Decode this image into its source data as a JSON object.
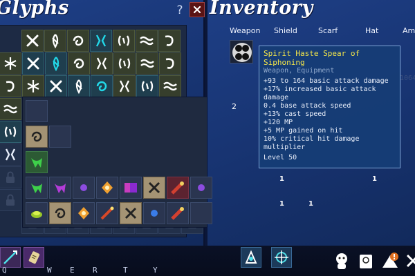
{
  "glyph_panel": {
    "title": "Glyphs",
    "help_label": "?",
    "close_icon": "close-icon"
  },
  "inventory_panel": {
    "title": "Inventory",
    "equipment_tabs": [
      "Weapon",
      "Shield",
      "Scarf",
      "Hat",
      "Amu"
    ],
    "weapon_count": "2",
    "item_counts": [
      "1",
      "1",
      "1",
      "1"
    ],
    "faded_number": "1064"
  },
  "tooltip": {
    "title": "Spirit Haste Spear of Siphoning",
    "subtitle": "Weapon, Equipment",
    "lines": [
      "+93 to 164 basic attack damage",
      "+17% increased basic attack",
      "damage",
      "0.4 base attack speed",
      "+13% cast speed",
      "+120 MP",
      "+5 MP gained on hit",
      "10% critical hit damage",
      "multiplier"
    ],
    "level": "Level 50"
  },
  "hotbar": {
    "keys": [
      "Q",
      "W",
      "E",
      "R",
      "T",
      "Y"
    ],
    "hud_icons": [
      "character-icon",
      "journal-icon",
      "map-alert-icon",
      "skills-icon"
    ]
  },
  "colors": {
    "panel_blue": "#1e3f86",
    "tooltip_title": "#f4e64a",
    "glyph_cyan": "#22d8e8",
    "glyph_purple": "#b04ce0",
    "close_red": "#5a1414"
  }
}
